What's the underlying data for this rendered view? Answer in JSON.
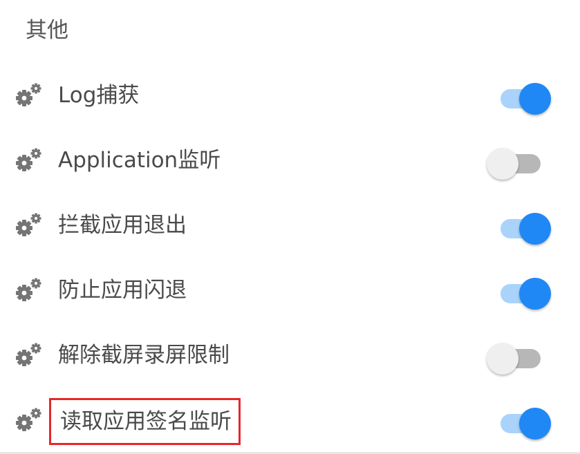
{
  "section": {
    "title": "其他"
  },
  "settings": [
    {
      "label": "Log捕获",
      "enabled": true
    },
    {
      "label": "Application监听",
      "enabled": false
    },
    {
      "label": "拦截应用退出",
      "enabled": true
    },
    {
      "label": "防止应用闪退",
      "enabled": true
    },
    {
      "label": "解除截屏录屏限制",
      "enabled": false
    },
    {
      "label": "读取应用签名监听",
      "enabled": true,
      "highlighted": true
    }
  ],
  "icons": {
    "setting": "gears-icon"
  },
  "colors": {
    "accent": "#1f88f5",
    "accent_track": "#a9d3fb",
    "off_knob": "#efefef",
    "off_track": "#b7b7b7",
    "highlight_border": "#e8252c",
    "text": "#4a4a4a",
    "icon": "#757575"
  }
}
